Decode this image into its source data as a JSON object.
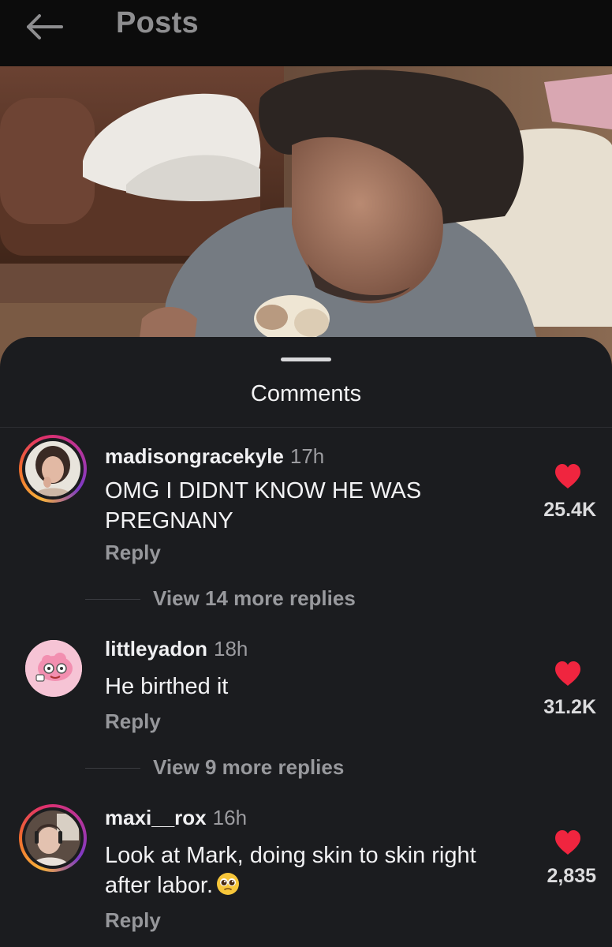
{
  "header": {
    "title": "Posts",
    "back_icon": "arrow-left-icon"
  },
  "sheet": {
    "title": "Comments"
  },
  "comments": [
    {
      "username": "madisongracekyle",
      "time": "17h",
      "text": "OMG I DIDNT KNOW HE WAS PREGNANY",
      "reply_label": "Reply",
      "likes": "25.4K",
      "view_replies": "View 14 more replies"
    },
    {
      "username": "littleyadon",
      "time": "18h",
      "text": "He birthed it",
      "reply_label": "Reply",
      "likes": "31.2K",
      "view_replies": "View 9 more replies"
    },
    {
      "username": "maxi__rox",
      "time": "16h",
      "text": "Look at Mark, doing skin to skin right after labor.",
      "emoji": "pleading-face-emoji",
      "reply_label": "Reply",
      "likes": "2,835"
    }
  ],
  "colors": {
    "sheet_bg": "#1b1c1f",
    "heart": "#f0253f",
    "muted_text": "#96979b"
  }
}
